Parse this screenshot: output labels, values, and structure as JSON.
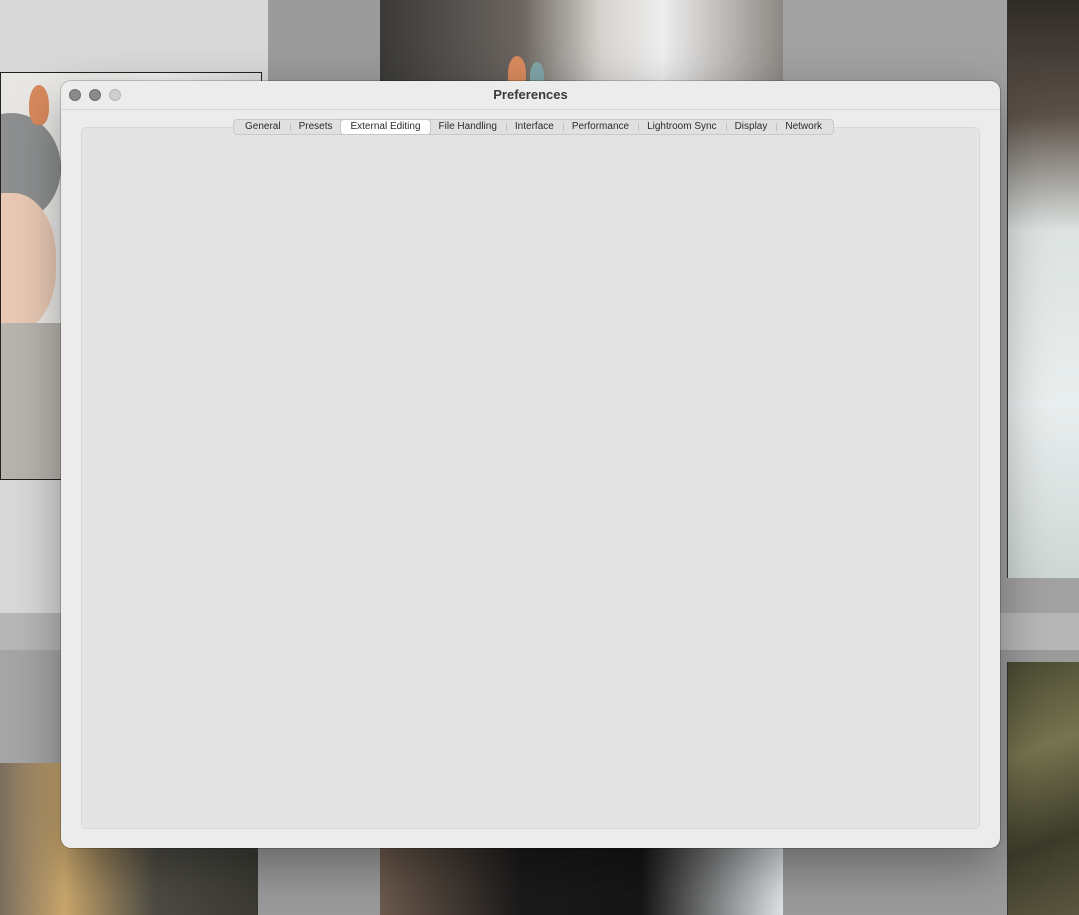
{
  "window": {
    "title": "Preferences"
  },
  "tabs": [
    {
      "label": "General",
      "active": false
    },
    {
      "label": "Presets",
      "active": false
    },
    {
      "label": "External Editing",
      "active": true
    },
    {
      "label": "File Handling",
      "active": false
    },
    {
      "label": "Interface",
      "active": false
    },
    {
      "label": "Performance",
      "active": false
    },
    {
      "label": "Lightroom Sync",
      "active": false
    },
    {
      "label": "Display",
      "active": false
    },
    {
      "label": "Network",
      "active": false
    }
  ],
  "colors": {
    "window_bg": "#ececec",
    "panel_bg": "#e4e4e4",
    "grid_bg": "#9b9b9b",
    "cell_light": "#d9d9d9"
  },
  "icons": [
    "close-icon",
    "minimize-icon",
    "zoom-icon"
  ]
}
